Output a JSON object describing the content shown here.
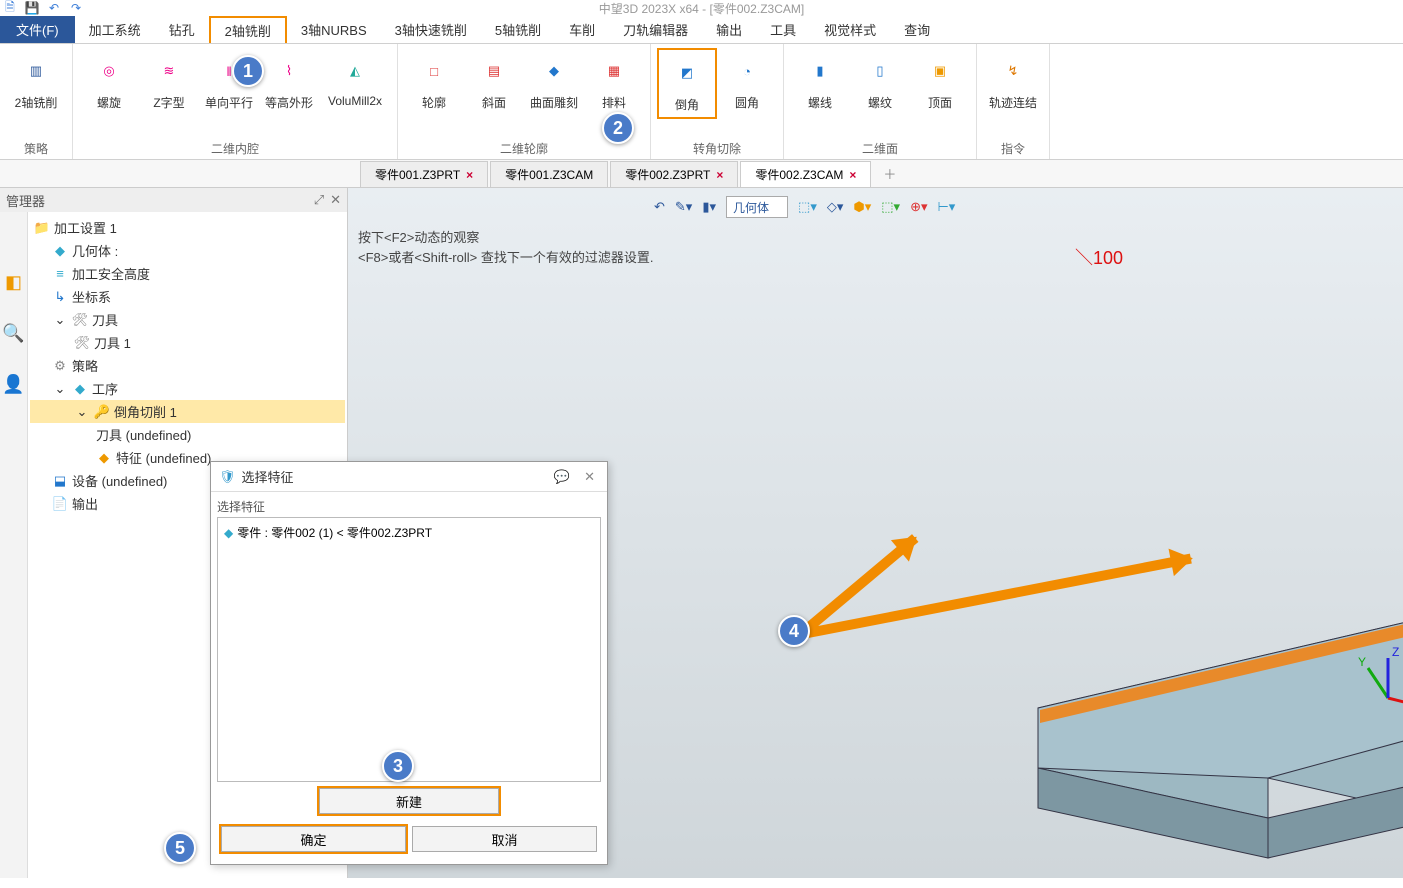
{
  "app_title": "中望3D 2023X x64 - [零件002.Z3CAM]",
  "menubar": {
    "file": "文件(F)",
    "items": [
      "加工系统",
      "钻孔",
      "2轴铣削",
      "3轴NURBS",
      "3轴快速铣削",
      "5轴铣削",
      "车削",
      "刀轨编辑器",
      "输出",
      "工具",
      "视觉样式",
      "查询"
    ]
  },
  "ribbon": {
    "groups": [
      {
        "label": "策略",
        "items": [
          {
            "name": "2轴铣削",
            "icon": "▥"
          }
        ]
      },
      {
        "label": "二维内腔",
        "items": [
          {
            "name": "螺旋",
            "icon": "◎"
          },
          {
            "name": "Z字型",
            "icon": "≋"
          },
          {
            "name": "单向平行",
            "icon": "‖"
          },
          {
            "name": "等高外形",
            "icon": "⌇"
          },
          {
            "name": "VoluMill2x",
            "icon": "◭"
          }
        ]
      },
      {
        "label": "二维轮廓",
        "items": [
          {
            "name": "轮廓",
            "icon": "□"
          },
          {
            "name": "斜面",
            "icon": "▤"
          },
          {
            "name": "曲面雕刻",
            "icon": "◆"
          },
          {
            "name": "排料",
            "icon": "▦"
          }
        ]
      },
      {
        "label": "转角切除",
        "items": [
          {
            "name": "倒角",
            "icon": "◩"
          },
          {
            "name": "圆角",
            "icon": "◔"
          }
        ]
      },
      {
        "label": "二维面",
        "items": [
          {
            "name": "螺线",
            "icon": "▮"
          },
          {
            "name": "螺纹",
            "icon": "▯"
          },
          {
            "name": "顶面",
            "icon": "▣"
          }
        ]
      },
      {
        "label": "指令",
        "items": [
          {
            "name": "轨迹连结",
            "icon": "↯"
          }
        ]
      }
    ]
  },
  "doc_tabs": [
    {
      "label": "零件001.Z3PRT",
      "active": false
    },
    {
      "label": "零件001.Z3CAM",
      "active": false
    },
    {
      "label": "零件002.Z3PRT",
      "active": false
    },
    {
      "label": "零件002.Z3CAM",
      "active": true
    }
  ],
  "manager": {
    "title": "管理器",
    "tree": {
      "root": "加工设置 1",
      "geom": "几何体 :",
      "safe": "加工安全高度",
      "csys": "坐标系",
      "tools": "刀具",
      "tool1": "刀具 1",
      "strategy": "策略",
      "ops": "工序",
      "op1": "倒角切削 1",
      "op1_tool": "刀具 (undefined)",
      "op1_feat": "特征 (undefined)",
      "device": "设备 (undefined)",
      "output": "输出"
    }
  },
  "viewport": {
    "dropdown": "几何体",
    "hint1": "按下<F2>动态的观察",
    "hint2": "<F8>或者<Shift-roll> 查找下一个有效的过滤器设置.",
    "dim": "100"
  },
  "dialog": {
    "title": "选择特征",
    "group": "选择特征",
    "item": "零件 : 零件002 (1) < 零件002.Z3PRT",
    "new": "新建",
    "ok": "确定",
    "cancel": "取消"
  },
  "callouts": {
    "c1": "1",
    "c2": "2",
    "c3": "3",
    "c4": "4",
    "c5": "5"
  }
}
